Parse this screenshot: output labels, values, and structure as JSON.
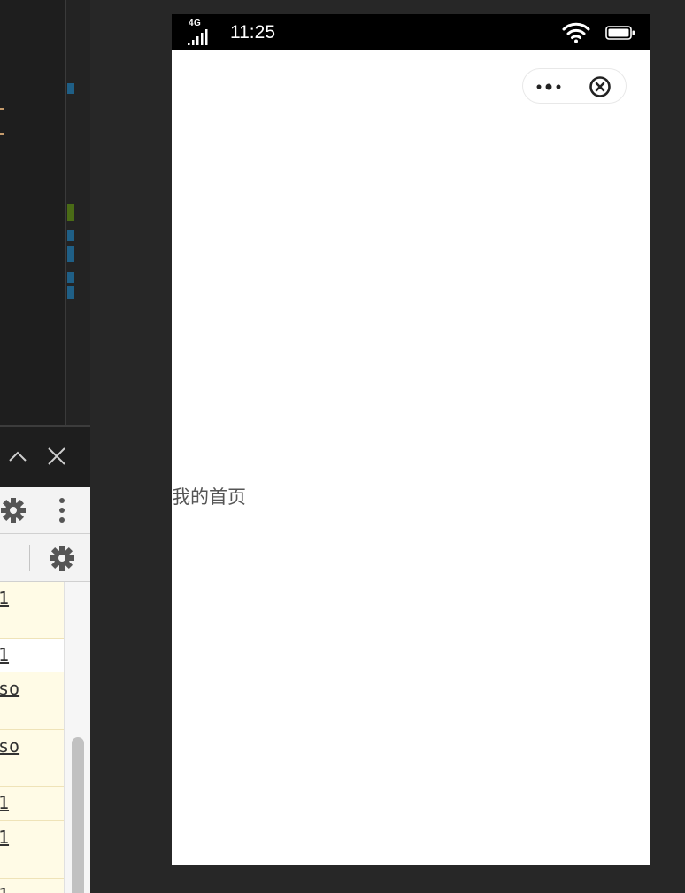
{
  "ide": {
    "panel_controls": {
      "collapse_icon": "chevron-up-icon",
      "close_icon": "close-icon"
    },
    "devtools": {
      "toolbar_icons": [
        "gear-icon",
        "kebab-menu-icon"
      ],
      "filter_icon": "gear-icon",
      "rows": [
        {
          "text": "1"
        },
        {
          "text": "1"
        },
        {
          "text": "so"
        },
        {
          "text": "so"
        },
        {
          "text": "1"
        },
        {
          "text": "1"
        },
        {
          "text": "1"
        }
      ]
    }
  },
  "simulator": {
    "status_bar": {
      "network": "4G",
      "time": "11:25",
      "icons": [
        "signal-icon",
        "wifi-icon",
        "battery-icon"
      ]
    },
    "capsule": {
      "more_icon": "more-dots-icon",
      "close_icon": "capsule-close-icon"
    },
    "page": {
      "text": "我的首页"
    }
  }
}
